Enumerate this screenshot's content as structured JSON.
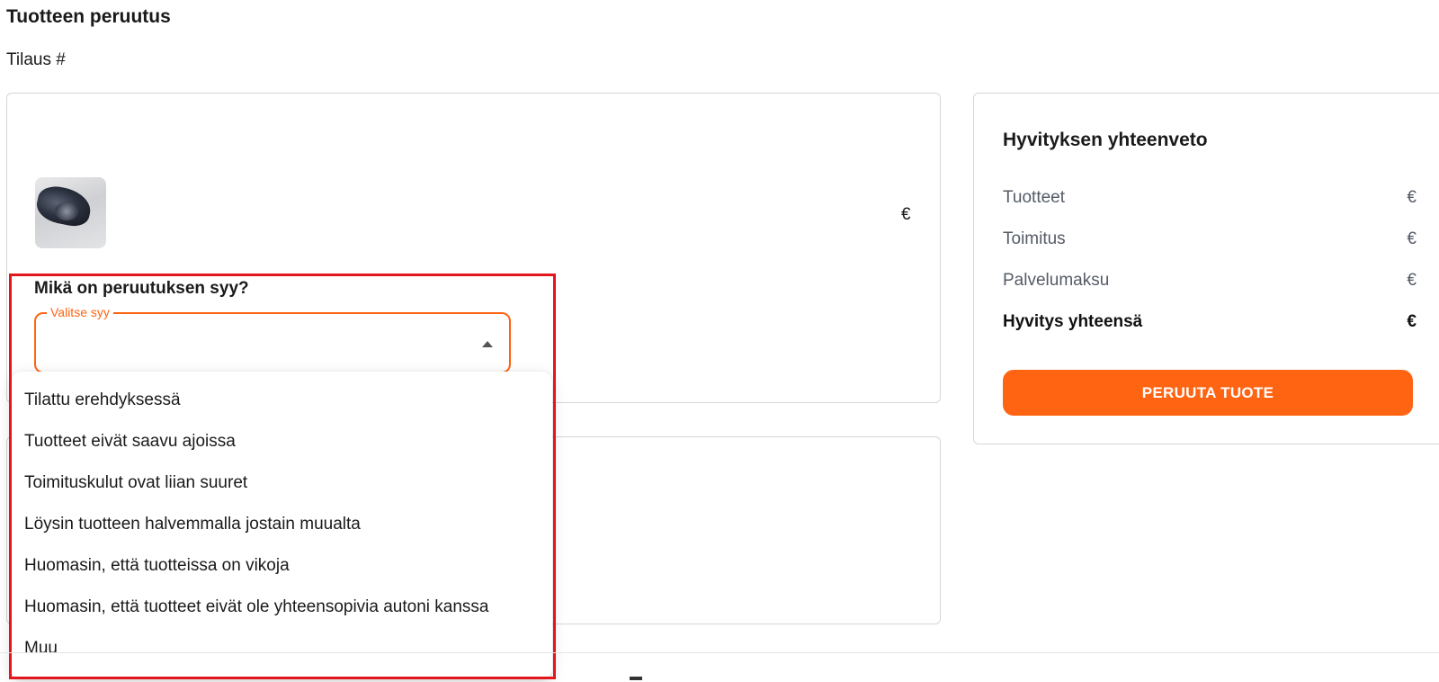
{
  "header": {
    "title": "Tuotteen peruutus",
    "order_label": "Tilaus #"
  },
  "product": {
    "image_icon": "headlight-product-image",
    "price": "€"
  },
  "cancel_reason": {
    "question": "Mikä on peruutuksen syy?",
    "select_label": "Valitse syy",
    "selected_value": "",
    "options": [
      "Tilattu erehdyksessä",
      "Tuotteet eivät saavu ajoissa",
      "Toimituskulut ovat liian suuret",
      "Löysin tuotteen halvemmalla jostain muualta",
      "Huomasin, että tuotteissa on vikoja",
      "Huomasin, että tuotteet eivät ole yhteensopivia autoni kanssa",
      "Muu"
    ]
  },
  "summary": {
    "title": "Hyvityksen yhteenveto",
    "rows": [
      {
        "label": "Tuotteet",
        "value": "€"
      },
      {
        "label": "Toimitus",
        "value": "€"
      },
      {
        "label": "Palvelumaksu",
        "value": "€"
      }
    ],
    "total": {
      "label": "Hyvitys yhteensä",
      "value": "€"
    },
    "button_label": "PERUUTA TUOTE"
  },
  "colors": {
    "accent": "#ff6412",
    "highlight": "#e2161c",
    "border": "#d6d6d6"
  }
}
